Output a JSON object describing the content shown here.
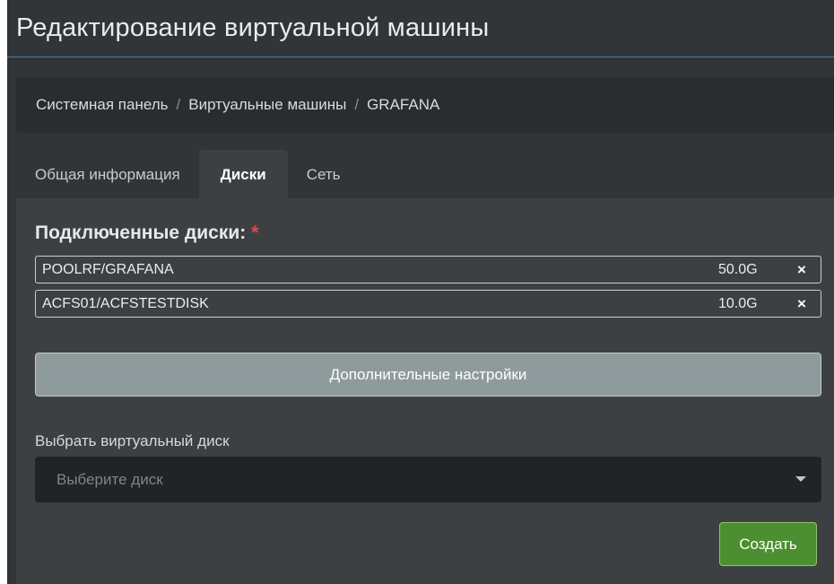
{
  "header": {
    "title": "Редактирование виртуальной машины"
  },
  "breadcrumb": {
    "items": [
      "Системная панель",
      "Виртуальные машины",
      "GRAFANA"
    ],
    "separator": "/"
  },
  "tabs": [
    {
      "label": "Общая информация",
      "active": false
    },
    {
      "label": "Диски",
      "active": true
    },
    {
      "label": "Сеть",
      "active": false
    }
  ],
  "disks": {
    "title": "Подключенные диски:",
    "required_mark": "*",
    "items": [
      {
        "name": "POOLRF/GRAFANA",
        "size": "50.0G",
        "remove": "×"
      },
      {
        "name": "ACFS01/ACFSTESTDISK",
        "size": "10.0G",
        "remove": "×"
      }
    ]
  },
  "advanced_button": "Дополнительные настройки",
  "select_disk": {
    "label": "Выбрать виртуальный диск",
    "placeholder": "Выберите диск",
    "icon": "caret-down-icon"
  },
  "create_button": "Создать",
  "colors": {
    "panel_bg": "#3d4043",
    "accent_line": "#4e7a9b",
    "required": "#e0474c",
    "create_green": "#4c8f31",
    "advanced_gray": "#8f9a9c"
  }
}
